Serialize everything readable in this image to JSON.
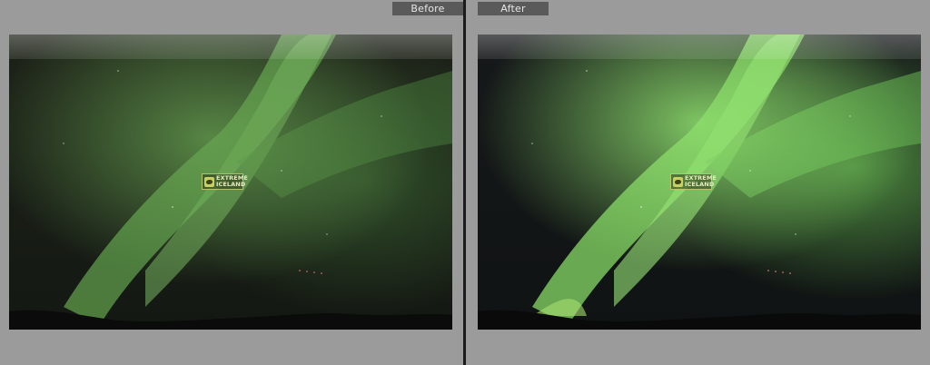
{
  "compare": {
    "before_label": "Before",
    "after_label": "After"
  },
  "watermark": {
    "line1": "EXTREME",
    "line2": "ICELAND"
  },
  "colors": {
    "aurora_before": "#5e9a4a",
    "aurora_after": "#7ed05f",
    "sky_before": "#1c2119",
    "sky_after": "#14181a",
    "panel_bg": "#9b9b9b",
    "label_bg": "#5a5a5a"
  }
}
